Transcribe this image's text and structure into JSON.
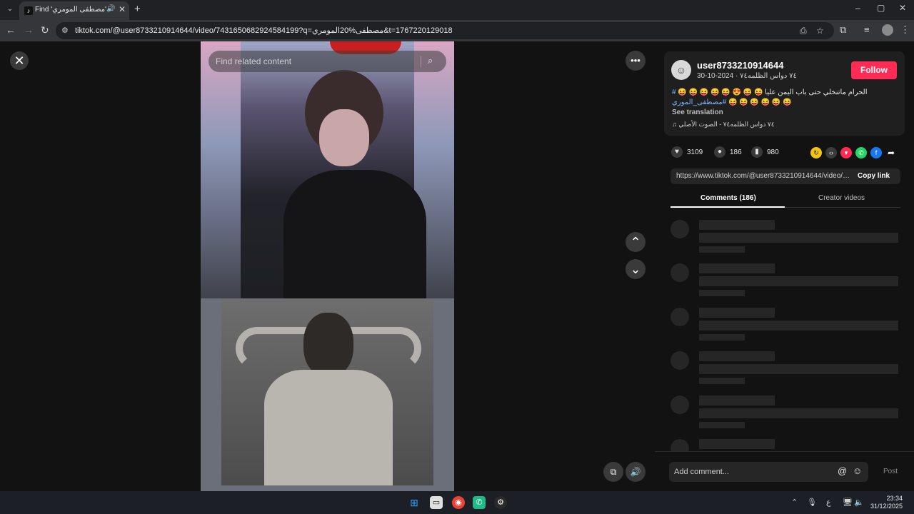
{
  "browser": {
    "tab_title": "Find 'مصطفى المومري' on",
    "tab_favicon": "tiktok-icon",
    "url": "tiktok.com/@user8733210914644/video/7431650682924584199?q=مصطفى%20المومري&t=1767220129018",
    "new_tab_icon": "+",
    "window_controls": [
      "–",
      "▢",
      "✕"
    ]
  },
  "video": {
    "search_placeholder": "Find related content",
    "close_icon": "✕",
    "more_icon": "•••",
    "up_icon": "⌃",
    "down_icon": "⌄",
    "volume_icon": "🔊",
    "float_icon": "⧉"
  },
  "author": {
    "username": "user8733210914644",
    "subline": "٧٤ دواس الظلمه٧٤ · 2024-10-30",
    "follow_label": "Follow"
  },
  "caption": {
    "line1_text": "الحرام ماتنخلي حتى باب اليمن عليا 😝 😝 😍 😝 😝 😝 😝 😝",
    "line1_tag": "#",
    "line2_tag": "#مصطفى_الموري",
    "line2_text": "😝 😝 😝 😝 😝 😝",
    "see_translation": "See translation",
    "music": "♫ ٧٤ دواس الظلمه٧٤ - الصوت الأصلي"
  },
  "stats": {
    "likes": "3109",
    "comments": "186",
    "saves": "980"
  },
  "link": {
    "url": "https://www.tiktok.com/@user8733210914644/video/7...",
    "copy_label": "Copy link"
  },
  "tabs": {
    "comments": "Comments (186)",
    "creator": "Creator videos"
  },
  "comment_box": {
    "placeholder": "Add comment...",
    "post_label": "Post"
  },
  "taskbar": {
    "time": "23:34",
    "date": "31/12/2025",
    "lang": "ع"
  },
  "colors": {
    "accent": "#fe2c55",
    "hashtag": "#7fb6ff"
  }
}
